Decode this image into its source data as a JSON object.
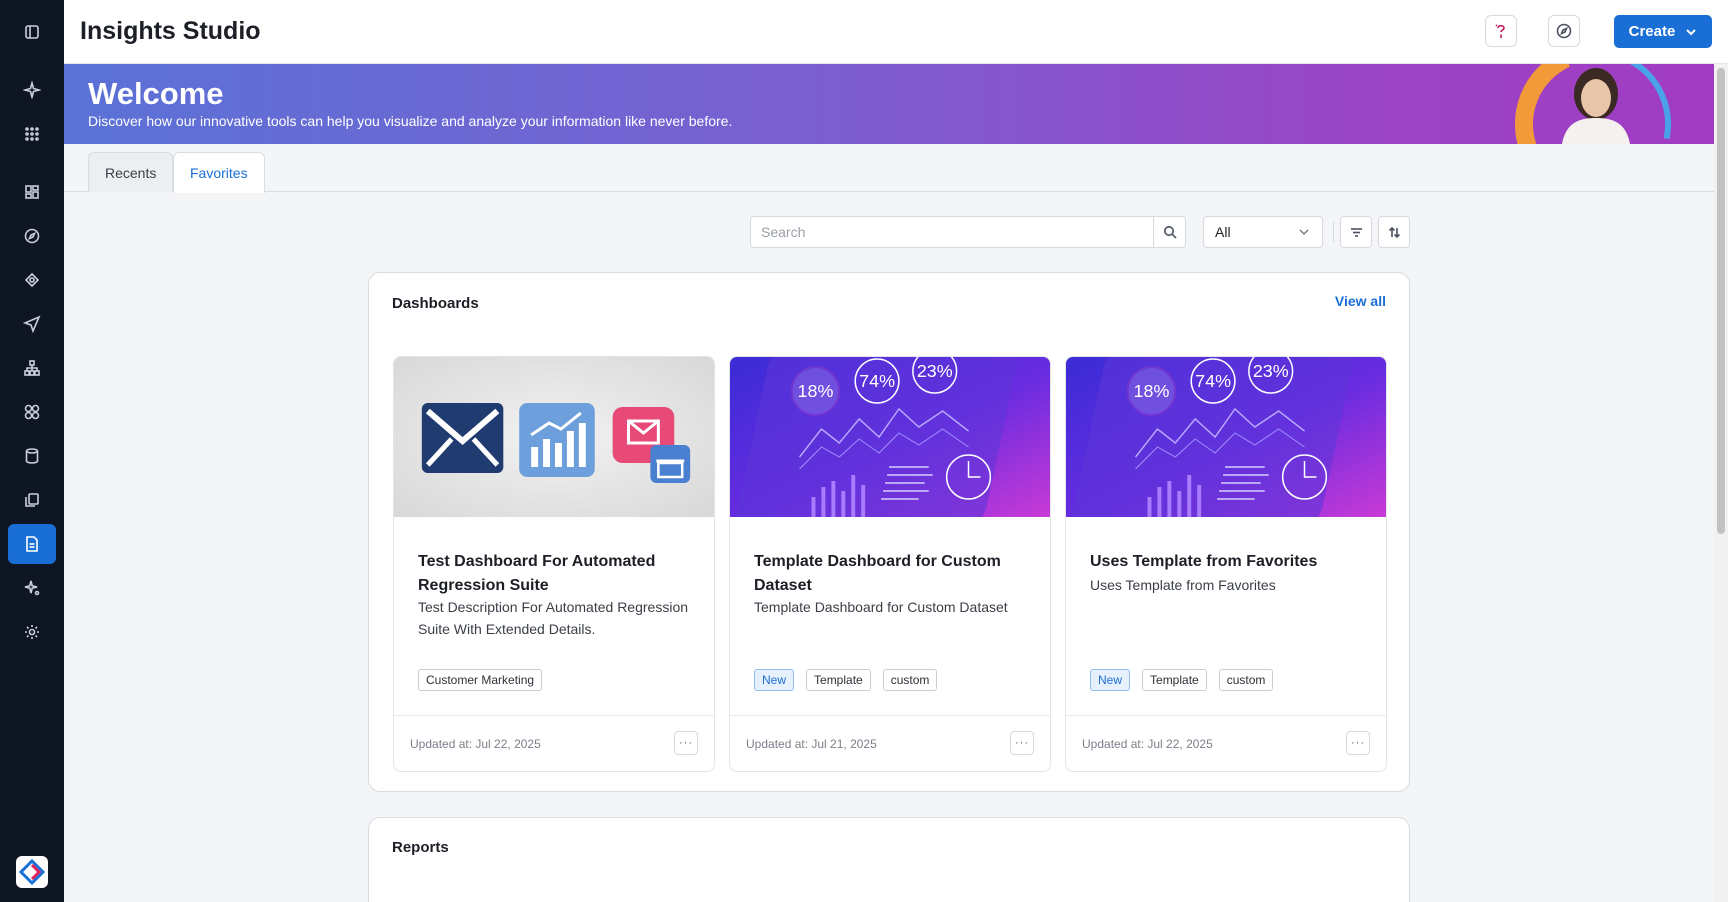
{
  "app": {
    "title": "Insights Studio"
  },
  "header": {
    "create_label": "Create"
  },
  "banner": {
    "title": "Welcome",
    "subtitle": "Discover how our innovative tools can help you visualize and analyze your information like never before."
  },
  "tabs": [
    {
      "label": "Recents",
      "active": false
    },
    {
      "label": "Favorites",
      "active": true
    }
  ],
  "toolbar": {
    "search_placeholder": "Search",
    "filter_value": "All"
  },
  "dashboards": {
    "title": "Dashboards",
    "view_all": "View all",
    "cards": [
      {
        "title": "Test Dashboard For Automated Regression Suite",
        "description": "Test Description For Automated Regression Suite With Extended Details.",
        "tags": [
          "Customer Marketing"
        ],
        "updated": "Updated at: Jul 22, 2025"
      },
      {
        "title": "Template Dashboard for Custom Dataset",
        "description": "Template Dashboard for Custom Dataset",
        "tags": [
          "New",
          "Template",
          "custom"
        ],
        "updated": "Updated at: Jul 21, 2025",
        "thumb_stats": [
          "18%",
          "74%",
          "23%"
        ]
      },
      {
        "title": "Uses Template from Favorites",
        "description": "Uses Template from Favorites",
        "tags": [
          "New",
          "Template",
          "custom"
        ],
        "updated": "Updated at: Jul 22, 2025",
        "thumb_stats": [
          "18%",
          "74%",
          "23%"
        ]
      }
    ]
  },
  "reports": {
    "title": "Reports"
  },
  "colors": {
    "accent": "#1a6fd6",
    "rail": "#0f1623",
    "banner_start": "#5a72d6",
    "banner_end": "#a03bc2"
  },
  "icons": {
    "rail": [
      "panel-toggle-icon",
      "sparkle-icon",
      "grid-icon",
      "dashboard-icon",
      "compass-icon",
      "target-icon",
      "send-icon",
      "hierarchy-icon",
      "modules-icon",
      "database-icon",
      "copy-icon",
      "report-icon",
      "sparkle-settings-icon",
      "settings-icon"
    ]
  }
}
